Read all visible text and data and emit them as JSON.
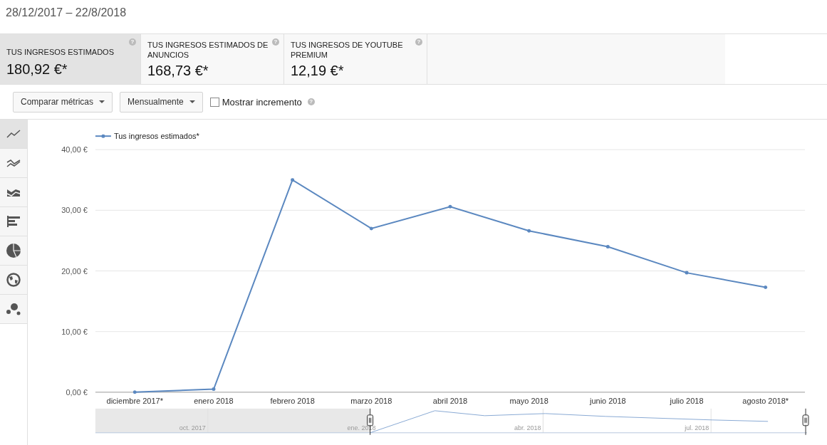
{
  "date_range": "28/12/2017 – 22/8/2018",
  "metric_cards": [
    {
      "label": "TUS INGRESOS ESTIMADOS",
      "value": "180,92 €*",
      "help": "?",
      "selected": true
    },
    {
      "label": "TUS INGRESOS ESTIMADOS DE ANUNCIOS",
      "value": "168,73 €*",
      "help": "?",
      "selected": false
    },
    {
      "label": "TUS INGRESOS DE YOUTUBE PREMIUM",
      "value": "12,19 €*",
      "help": "?",
      "selected": false
    }
  ],
  "toolbar": {
    "compare_button": "Comparar métricas",
    "period_button": "Mensualmente",
    "growth_checkbox": {
      "label": "Mostrar incremento",
      "checked": false,
      "help": "?"
    }
  },
  "chart_types": [
    {
      "kind": "line",
      "selected": true
    },
    {
      "kind": "multiline",
      "selected": false
    },
    {
      "kind": "area",
      "selected": false
    },
    {
      "kind": "bar",
      "selected": false
    },
    {
      "kind": "pie",
      "selected": false
    },
    {
      "kind": "map",
      "selected": false
    },
    {
      "kind": "bubble",
      "selected": false
    }
  ],
  "chart_data": {
    "type": "line",
    "grid": true,
    "categories": [
      "diciembre 2017*",
      "enero 2018",
      "febrero 2018",
      "marzo 2018",
      "abril 2018",
      "mayo 2018",
      "junio 2018",
      "julio 2018",
      "agosto 2018*"
    ],
    "series": [
      {
        "name": "Tus ingresos estimados*",
        "color": "#5b88c0",
        "values": [
          0,
          0.5,
          35,
          27,
          30.6,
          26.6,
          24,
          19.7,
          17.3
        ]
      }
    ],
    "ylim": [
      0,
      40
    ],
    "yticks": [
      {
        "value": 0,
        "label": "0,00 €"
      },
      {
        "value": 10,
        "label": "10,00 €"
      },
      {
        "value": 20,
        "label": "20,00 €"
      },
      {
        "value": 30,
        "label": "30,00 €"
      },
      {
        "value": 40,
        "label": "40,00 €"
      }
    ]
  },
  "navigator": {
    "labels": [
      "oct. 2017",
      "ene. 2018",
      "abr. 2018",
      "jul. 2018"
    ]
  }
}
